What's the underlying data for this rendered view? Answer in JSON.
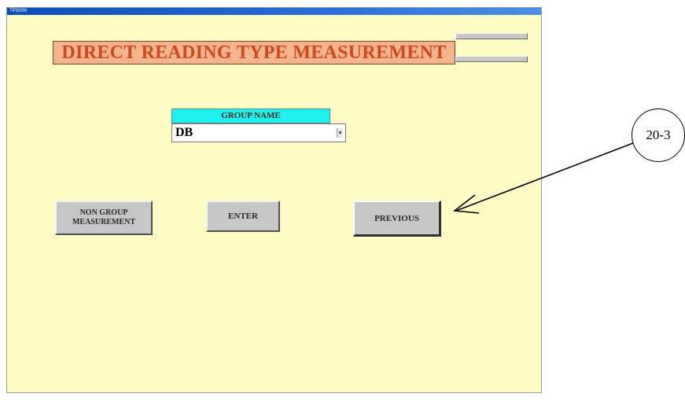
{
  "window": {
    "title": "TP500N"
  },
  "header": {
    "title": "DIRECT READING TYPE MEASUREMENT"
  },
  "group": {
    "label": "GROUP NAME",
    "selected_value": "DB",
    "dropdown_glyph": "▾"
  },
  "buttons": {
    "non_group_line1": "NON GROUP",
    "non_group_line2": "MEASUREMENT",
    "enter": "ENTER",
    "previous": "PREVIOUS"
  },
  "callout": {
    "label": "20-3"
  },
  "colors": {
    "background": "#fefcc4",
    "title_bg": "#f4b48e",
    "title_text": "#d0481e",
    "group_label_bg": "#1ef0f0",
    "button_face": "#c6c6c6"
  },
  "icons": {
    "dropdown": "chevron-down-icon",
    "callout_arrow": "arrow-icon"
  }
}
